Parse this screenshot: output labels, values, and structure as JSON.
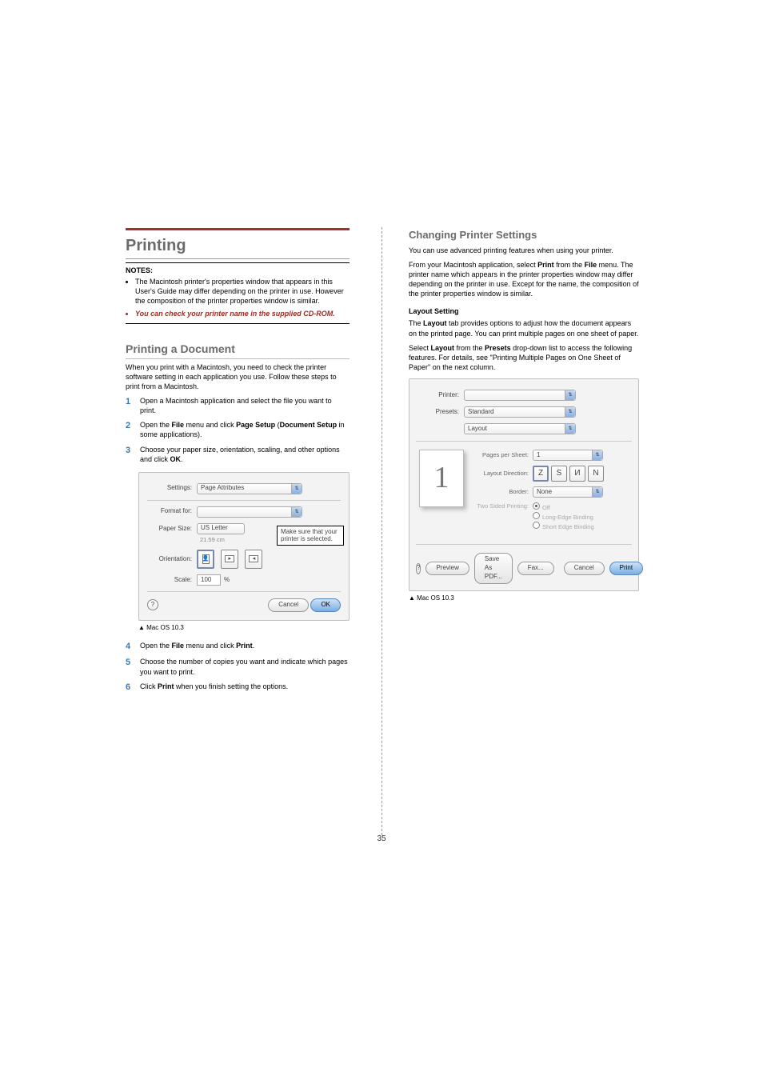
{
  "page_number": "35",
  "left": {
    "h1": "Printing",
    "notes_label": "NOTES",
    "note1": "The Macintosh printer's properties window that appears in this User's Guide may differ depending on the printer in use. However the composition of the printer properties window is similar.",
    "note2": "You can check your printer name in the supplied CD-ROM.",
    "h2": "Printing a Document",
    "intro": "When you print with a Macintosh, you need to check the printer software setting in each application you use. Follow these steps to print from a Macintosh.",
    "steps": {
      "s1": "Open a Macintosh application and select the file you want to print.",
      "s2a": "Open the ",
      "s2b": "File",
      "s2c": " menu and click ",
      "s2d": "Page Setup",
      "s2e": " (",
      "s2f": "Document Setup",
      "s2g": " in some applications).",
      "s3a": "Choose your paper size, orientation, scaling, and other options and click ",
      "s3b": "OK",
      "s3c": ".",
      "s4a": "Open the ",
      "s4b": "File",
      "s4c": " menu and click ",
      "s4d": "Print",
      "s4e": ".",
      "s5": "Choose the number of copies you want and indicate which pages you want to print.",
      "s6a": "Click ",
      "s6b": "Print",
      "s6c": " when you finish setting the options."
    },
    "dialog": {
      "settings_label": "Settings:",
      "settings_value": "Page Attributes",
      "format_label": "Format for:",
      "paper_label": "Paper Size:",
      "paper_value": "US Letter",
      "paper_dim": "21.59 cm",
      "orient_label": "Orientation:",
      "scale_label": "Scale:",
      "scale_value": "100",
      "scale_pct": "%",
      "cancel": "Cancel",
      "ok": "OK",
      "callout": "Make sure that your printer is selected."
    },
    "caption": "▲ Mac OS 10.3"
  },
  "right": {
    "h3": "Changing Printer Settings",
    "p1": "You can use advanced printing features when using your printer.",
    "p2a": "From your Macintosh application, select ",
    "p2b": "Print",
    "p2c": " from the ",
    "p2d": "File",
    "p2e": " menu. The printer name which appears in the printer properties window may differ depending on the printer in use. Except for the name, the composition of the printer properties window is similar.",
    "h4": "Layout Setting",
    "p3a": "The ",
    "p3b": "Layout",
    "p3c": " tab provides options to adjust how the document appears on the printed page. You can print multiple pages on one sheet of paper.",
    "p4a": "Select ",
    "p4b": "Layout",
    "p4c": " from the ",
    "p4d": "Presets",
    "p4e": " drop-down list to access the following features. For details, see \"Printing Multiple Pages on One Sheet of Paper\" on the next column.",
    "dialog": {
      "printer_label": "Printer:",
      "presets_label": "Presets:",
      "presets_value": "Standard",
      "layout_value": "Layout",
      "pps_label": "Pages per Sheet:",
      "pps_value": "1",
      "dir_label": "Layout Direction:",
      "border_label": "Border:",
      "border_value": "None",
      "tsp_label": "Two Sided Printing:",
      "tsp_off": "Off",
      "tsp_long": "Long-Edge Binding",
      "tsp_short": "Short Edge Binding",
      "preview": "Preview",
      "save_pdf": "Save As PDF...",
      "fax": "Fax...",
      "cancel": "Cancel",
      "print": "Print",
      "big1": "1"
    },
    "caption": "▲ Mac OS 10.3"
  }
}
